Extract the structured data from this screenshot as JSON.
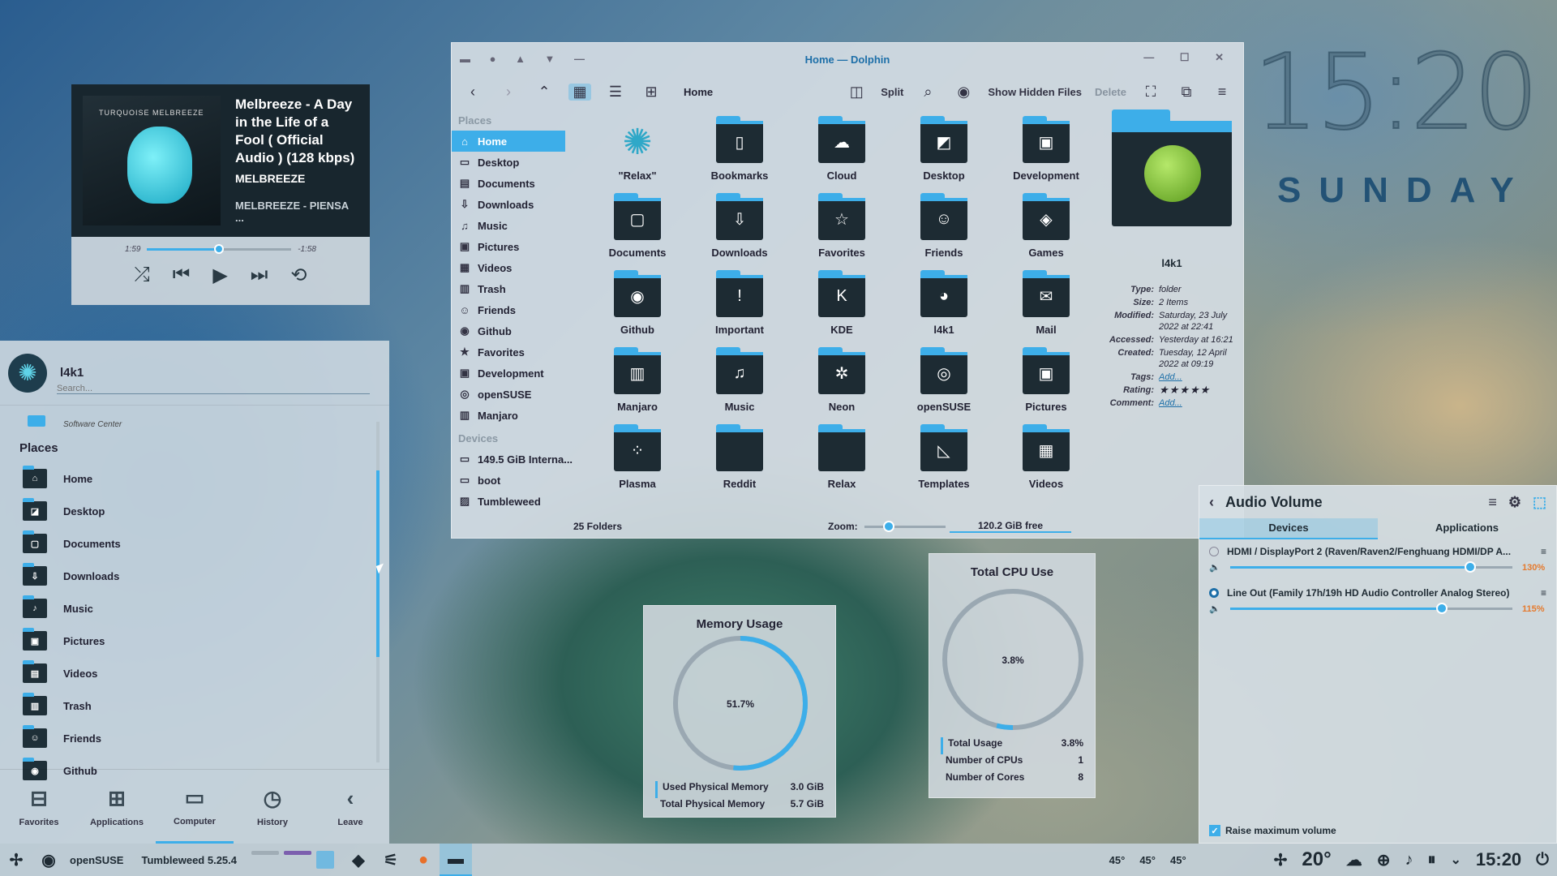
{
  "desktop": {
    "clock": "15:20",
    "day": "SUNDAY"
  },
  "player": {
    "cover_text": "TURQUOISE MELBREEZE",
    "title": "Melbreeze - A Day in the Life of a Fool ( Official Audio ) (128 kbps)",
    "artist": "MELBREEZE",
    "album": "MELBREEZE - PIENSA ...",
    "elapsed": "1:59",
    "remaining": "-1:58",
    "progress": 0.5,
    "icons": [
      "shuffle-icon",
      "previous-icon",
      "play-icon",
      "next-icon",
      "repeat-icon"
    ]
  },
  "launcher": {
    "user": "l4k1",
    "search_placeholder": "Search...",
    "prev_item": "Software Center",
    "places_label": "Places",
    "places": [
      {
        "label": "Home",
        "glyph": "⌂"
      },
      {
        "label": "Desktop",
        "glyph": "◪"
      },
      {
        "label": "Documents",
        "glyph": "▢"
      },
      {
        "label": "Downloads",
        "glyph": "⇩"
      },
      {
        "label": "Music",
        "glyph": "♪"
      },
      {
        "label": "Pictures",
        "glyph": "▣"
      },
      {
        "label": "Videos",
        "glyph": "▤"
      },
      {
        "label": "Trash",
        "glyph": "▥"
      },
      {
        "label": "Friends",
        "glyph": "☺"
      },
      {
        "label": "Github",
        "glyph": "◉"
      }
    ],
    "tabs": [
      {
        "label": "Favorites",
        "glyph": "⊟"
      },
      {
        "label": "Applications",
        "glyph": "⊞"
      },
      {
        "label": "Computer",
        "glyph": "▭"
      },
      {
        "label": "History",
        "glyph": "◷"
      },
      {
        "label": "Leave",
        "glyph": "‹"
      }
    ],
    "selected_tab": "Computer"
  },
  "dolphin": {
    "title": "Home — Dolphin",
    "breadcrumb": "Home",
    "toolbar": {
      "split": "Split",
      "hidden": "Show Hidden Files",
      "delete": "Delete"
    },
    "places_header": "Places",
    "places": [
      {
        "label": "Home",
        "glyph": "⌂"
      },
      {
        "label": "Desktop",
        "glyph": "▭"
      },
      {
        "label": "Documents",
        "glyph": "▤"
      },
      {
        "label": "Downloads",
        "glyph": "⇩"
      },
      {
        "label": "Music",
        "glyph": "♫"
      },
      {
        "label": "Pictures",
        "glyph": "▣"
      },
      {
        "label": "Videos",
        "glyph": "▦"
      },
      {
        "label": "Trash",
        "glyph": "▥"
      },
      {
        "label": "Friends",
        "glyph": "☺"
      },
      {
        "label": "Github",
        "glyph": "◉"
      },
      {
        "label": "Favorites",
        "glyph": "★"
      },
      {
        "label": "Development",
        "glyph": "▣"
      },
      {
        "label": "openSUSE",
        "glyph": "◎"
      },
      {
        "label": "Manjaro",
        "glyph": "▥"
      }
    ],
    "devices_header": "Devices",
    "devices": [
      {
        "label": "149.5 GiB Interna...",
        "glyph": "▭"
      },
      {
        "label": "boot",
        "glyph": "▭"
      },
      {
        "label": "Tumbleweed",
        "glyph": "▨"
      }
    ],
    "folders": [
      {
        "label": "\"Relax\"",
        "glyph": "✺"
      },
      {
        "label": "Bookmarks",
        "glyph": "▯"
      },
      {
        "label": "Cloud",
        "glyph": "☁"
      },
      {
        "label": "Desktop",
        "glyph": "◩"
      },
      {
        "label": "Development",
        "glyph": "▣"
      },
      {
        "label": "Documents",
        "glyph": "▢"
      },
      {
        "label": "Downloads",
        "glyph": "⇩"
      },
      {
        "label": "Favorites",
        "glyph": "☆"
      },
      {
        "label": "Friends",
        "glyph": "☺"
      },
      {
        "label": "Games",
        "glyph": "◈"
      },
      {
        "label": "Github",
        "glyph": "◉"
      },
      {
        "label": "Important",
        "glyph": "!"
      },
      {
        "label": "KDE",
        "glyph": "K"
      },
      {
        "label": "l4k1",
        "glyph": "◕"
      },
      {
        "label": "Mail",
        "glyph": "✉"
      },
      {
        "label": "Manjaro",
        "glyph": "▥"
      },
      {
        "label": "Music",
        "glyph": "♫"
      },
      {
        "label": "Neon",
        "glyph": "✲"
      },
      {
        "label": "openSUSE",
        "glyph": "◎"
      },
      {
        "label": "Pictures",
        "glyph": "▣"
      },
      {
        "label": "Plasma",
        "glyph": "⁘"
      },
      {
        "label": "Reddit",
        "glyph": ""
      },
      {
        "label": "Relax",
        "glyph": ""
      },
      {
        "label": "Templates",
        "glyph": "◺"
      },
      {
        "label": "Videos",
        "glyph": "▦"
      }
    ],
    "info": {
      "name": "l4k1",
      "rows": [
        {
          "k": "Type:",
          "v": "folder"
        },
        {
          "k": "Size:",
          "v": "2 Items"
        },
        {
          "k": "Modified:",
          "v": "Saturday, 23 July 2022 at 22:41"
        },
        {
          "k": "Accessed:",
          "v": "Yesterday at 16:21"
        },
        {
          "k": "Created:",
          "v": "Tuesday, 12 April 2022 at 09:19"
        },
        {
          "k": "Tags:",
          "v": "Add..."
        },
        {
          "k": "Rating:",
          "v": "★★★★★"
        },
        {
          "k": "Comment:",
          "v": "Add..."
        }
      ]
    },
    "status": {
      "count": "25 Folders",
      "zoom_label": "Zoom:",
      "zoom_level": 0.3,
      "free": "120.2 GiB free"
    }
  },
  "memory": {
    "title": "Memory Usage",
    "value": "51.7%",
    "fraction": 0.517,
    "rows": [
      {
        "k": "Used Physical Memory",
        "v": "3.0 GiB"
      },
      {
        "k": "Total Physical Memory",
        "v": "5.7 GiB"
      }
    ]
  },
  "cpu": {
    "title": "Total CPU Use",
    "value": "3.8%",
    "fraction": 0.038,
    "rows": [
      {
        "k": "Total Usage",
        "v": "3.8%"
      },
      {
        "k": "Number of CPUs",
        "v": "1"
      },
      {
        "k": "Number of Cores",
        "v": "8"
      }
    ]
  },
  "audio": {
    "title": "Audio Volume",
    "tabs": [
      "Devices",
      "Applications"
    ],
    "devices": [
      {
        "name": "HDMI / DisplayPort 2 (Raven/Raven2/Fenghuang HDMI/DP A...",
        "pct": "130%",
        "level": 0.85,
        "active": false
      },
      {
        "name": "Line Out (Family 17h/19h HD Audio Controller Analog Stereo)",
        "pct": "115%",
        "level": 0.75,
        "active": true
      }
    ],
    "raise_label": "Raise maximum volume"
  },
  "taskbar": {
    "distro": "openSUSE",
    "version": "Tumbleweed 5.25.4",
    "temps": [
      "45°",
      "45°",
      "45°"
    ],
    "weather": "20°",
    "clock": "15:20",
    "accent": "#3daee9"
  }
}
